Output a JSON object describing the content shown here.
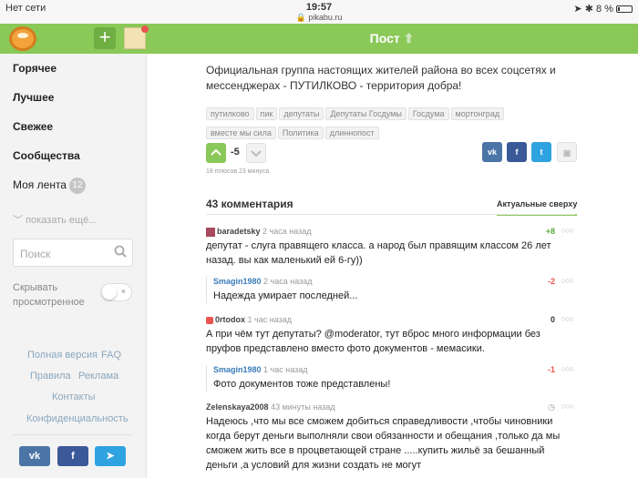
{
  "status": {
    "carrier": "Нет сети",
    "time": "19:57",
    "url": "pikabu.ru",
    "battery": "8 %"
  },
  "header": {
    "title": "Пост"
  },
  "sidebar": {
    "nav": [
      "Горячее",
      "Лучшее",
      "Свежее",
      "Сообщества"
    ],
    "feed_label": "Моя лента",
    "feed_count": "12",
    "show_more": "показать ещё...",
    "search_placeholder": "Поиск",
    "hide_label": "Скрывать просмотренное",
    "links": {
      "full": "Полная версия",
      "faq": "FAQ",
      "rules": "Правила",
      "ads": "Реклама",
      "contacts": "Контакты",
      "privacy": "Конфиденциальность"
    },
    "social": {
      "vk": "vk",
      "fb": "f",
      "tg": "➤"
    }
  },
  "post": {
    "description": "Официальная группа настоящих жителей района во всех соцсетях и мессенджерах - ПУТИЛКОВО - территория добра!",
    "tags": [
      "путилково",
      "пик",
      "депутаты",
      "Депутаты Госдумы",
      "Госдума",
      "мортонград",
      "вместе мы сила",
      "Политика",
      "длиннопост"
    ],
    "rating": "-5",
    "vote_stats": "18 плюсов 23 минуса"
  },
  "comments": {
    "title": "43 комментария",
    "sort": "Актуальные сверху",
    "items": [
      {
        "author": "baradetsky",
        "time": "2 часа назад",
        "rating": "+8",
        "text": "депутат - слуга правящего класса. а народ был правящим классом 26 лет назад. вы как маленький ей 6-гу))"
      },
      {
        "author": "Smagin1980",
        "time": "2 часа назад",
        "rating": "-2",
        "text": "Надежда умирает последней..."
      },
      {
        "author": "0rtodox",
        "time": "1 час назад",
        "rating": "0",
        "text": "А при чём тут депутаты? @moderator, тут вброс много информации без пруфов представлено вместо фото документов - мемасики."
      },
      {
        "author": "Smagin1980",
        "time": "1 час назад",
        "rating": "-1",
        "text": "Фото документов тоже представлены!"
      },
      {
        "author": "Zelenskaya2008",
        "time": "43 минуты назад",
        "rating": "",
        "text": "Надеюсь ,что мы все сможем добиться справедливости ,чтобы чиновники когда берут деньги выполняли свои обязанности и обещания ,только да мы сможем жить все в процветающей стране .....купить жильё за бешанный деньги ,а условий для жизни создать не могут"
      }
    ]
  },
  "colors": {
    "green": "#8ac858",
    "vk": "#4b75a6",
    "fb": "#3b5998",
    "tw": "#2fa3e0",
    "tg": "#2fa3e0",
    "neg": "#e8554e",
    "pos": "#5aa83a"
  }
}
